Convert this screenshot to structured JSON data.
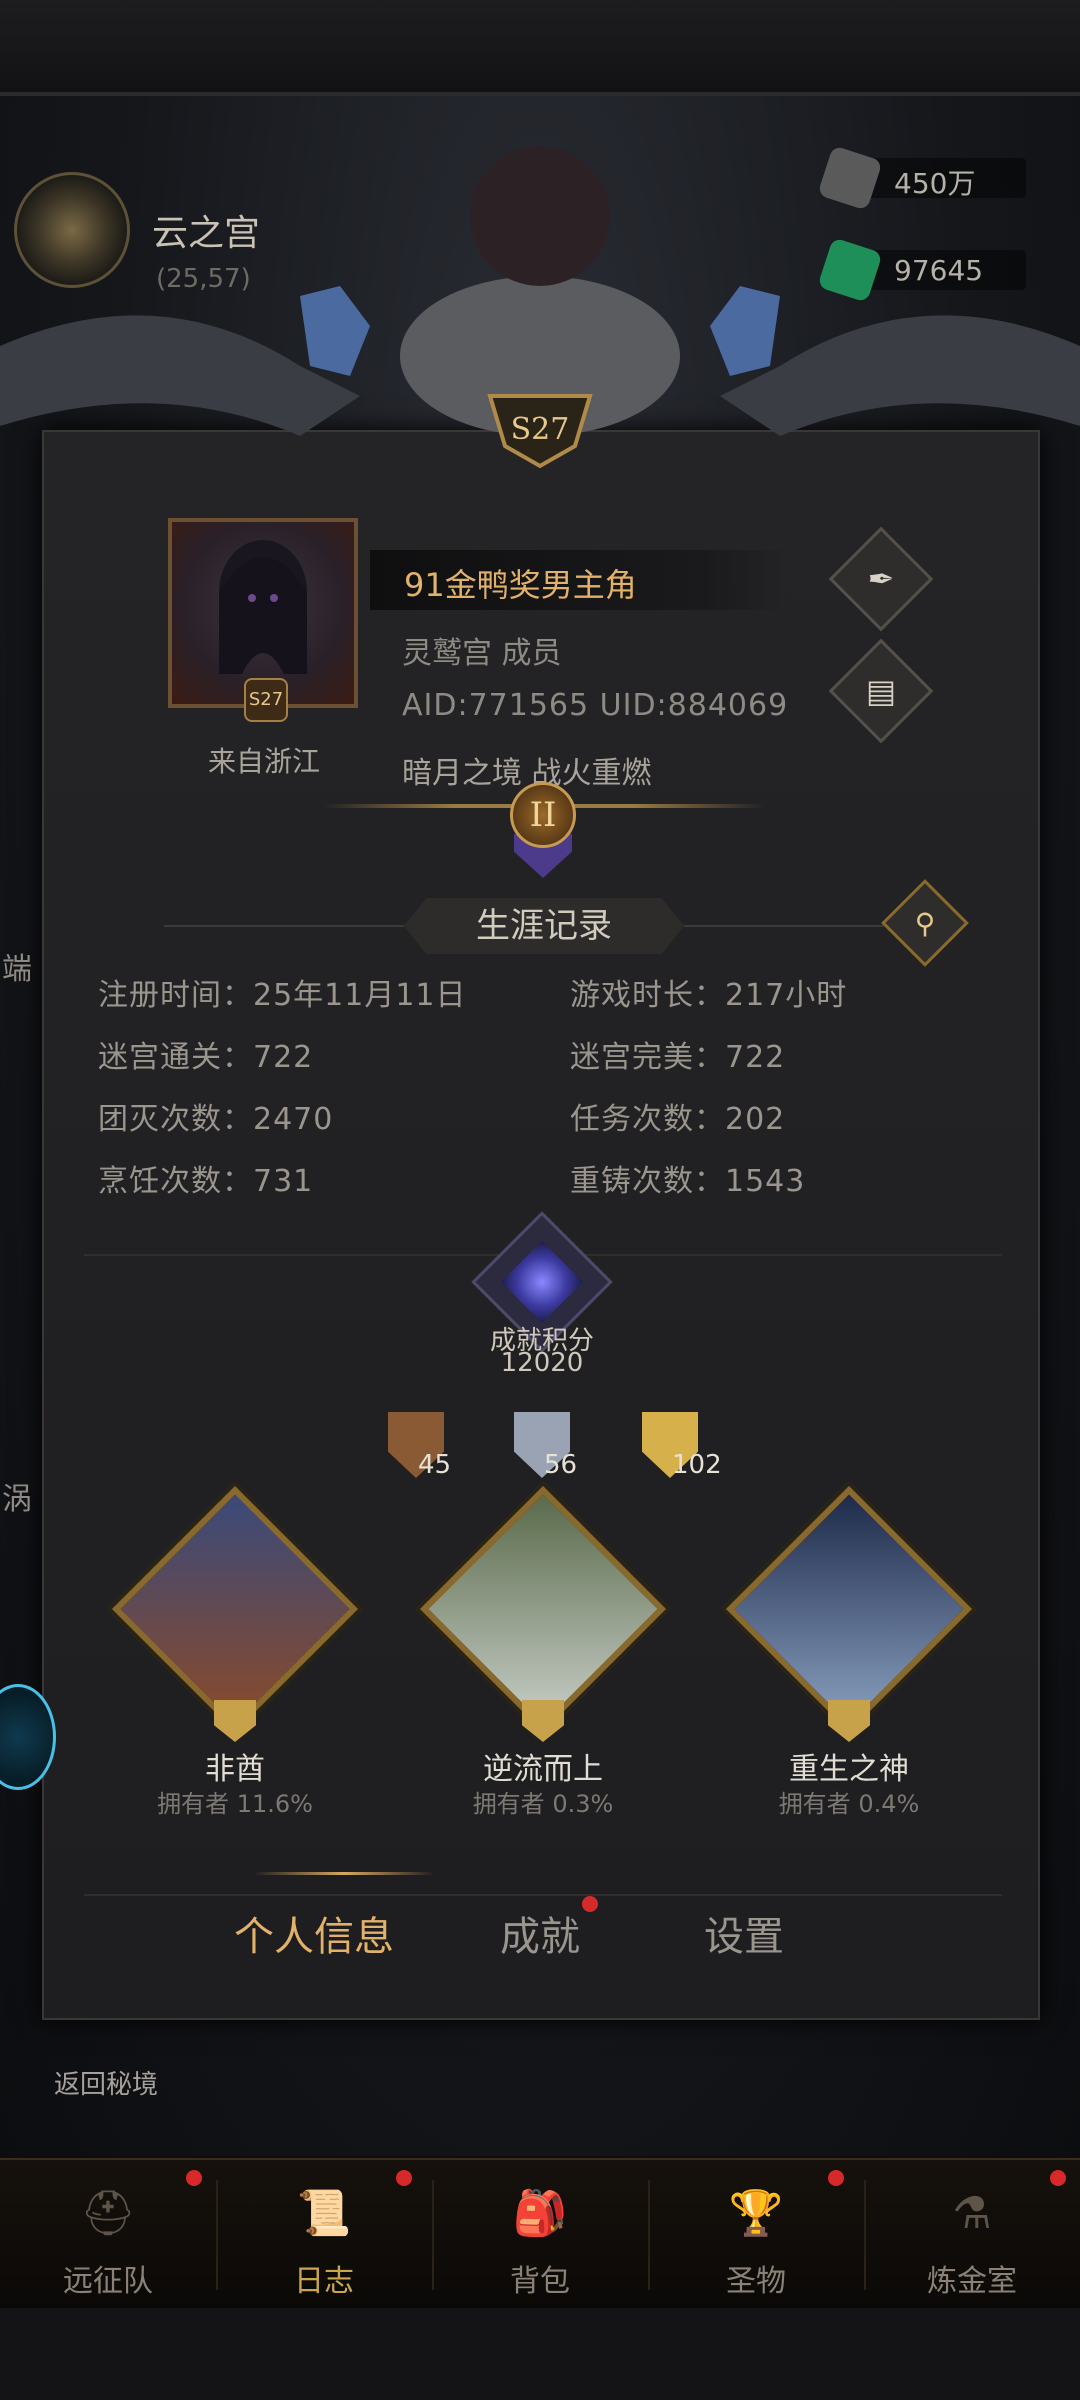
{
  "location": {
    "name": "云之宫",
    "coords": "(25,57)"
  },
  "currencies": [
    {
      "icon": "ore-icon",
      "value": "450万",
      "color": "#6a6a6a"
    },
    {
      "icon": "green-gem-icon",
      "value": "97645",
      "color": "#1f8f5a"
    }
  ],
  "crest": {
    "season": "S27"
  },
  "profile": {
    "avatar_season": "S27",
    "origin": "来自浙江",
    "name": "91金鸭奖男主角",
    "guild": "灵鹫宫  成员",
    "ids": "AID:771565 UID:884069",
    "motto": "暗月之境  战火重燃",
    "edit_icon": "quill-icon",
    "copy_icon": "document-icon",
    "rank": "II"
  },
  "career": {
    "title": "生涯记录",
    "search_icon": "magnifier-icon",
    "stats": [
      {
        "label": "注册时间：25年11月11日"
      },
      {
        "label": "游戏时长：217小时"
      },
      {
        "label": "迷宫通关：722"
      },
      {
        "label": "迷宫完美：722"
      },
      {
        "label": "团灭次数：2470"
      },
      {
        "label": "任务次数：202"
      },
      {
        "label": "烹饪次数：731"
      },
      {
        "label": "重铸次数：1543"
      }
    ]
  },
  "achievement": {
    "label": "成就积分",
    "score": "12020",
    "medals": [
      {
        "tier": "bronze",
        "count": "45",
        "color": "#8a5a34"
      },
      {
        "tier": "silver",
        "count": "56",
        "color": "#9aa3b3"
      },
      {
        "tier": "gold",
        "count": "102",
        "color": "#d6b04a"
      }
    ],
    "trophies": [
      {
        "name": "非酋",
        "owners": "拥有者  11.6%"
      },
      {
        "name": "逆流而上",
        "owners": "拥有者  0.3%"
      },
      {
        "name": "重生之神",
        "owners": "拥有者  0.4%"
      }
    ]
  },
  "tabs": [
    {
      "label": "个人信息",
      "active": true
    },
    {
      "label": "成就",
      "active": false,
      "notification": true
    },
    {
      "label": "设置",
      "active": false
    }
  ],
  "side": {
    "left_label_1": "端",
    "left_label_2": "涡",
    "return_label": "返回秘境"
  },
  "bottom_nav": [
    {
      "label": "远征队",
      "icon": "viking-helmet-icon",
      "active": false,
      "notification": true
    },
    {
      "label": "日志",
      "icon": "scroll-icon",
      "active": true,
      "notification": true
    },
    {
      "label": "背包",
      "icon": "backpack-icon",
      "active": false,
      "notification": false
    },
    {
      "label": "圣物",
      "icon": "chalice-icon",
      "active": false,
      "notification": true
    },
    {
      "label": "炼金室",
      "icon": "alchemy-icon",
      "active": false,
      "notification": true
    }
  ],
  "colors": {
    "accent_gold": "#e2b26a",
    "panel_bg": "#1e1e20",
    "notification_red": "#d62a2a"
  }
}
